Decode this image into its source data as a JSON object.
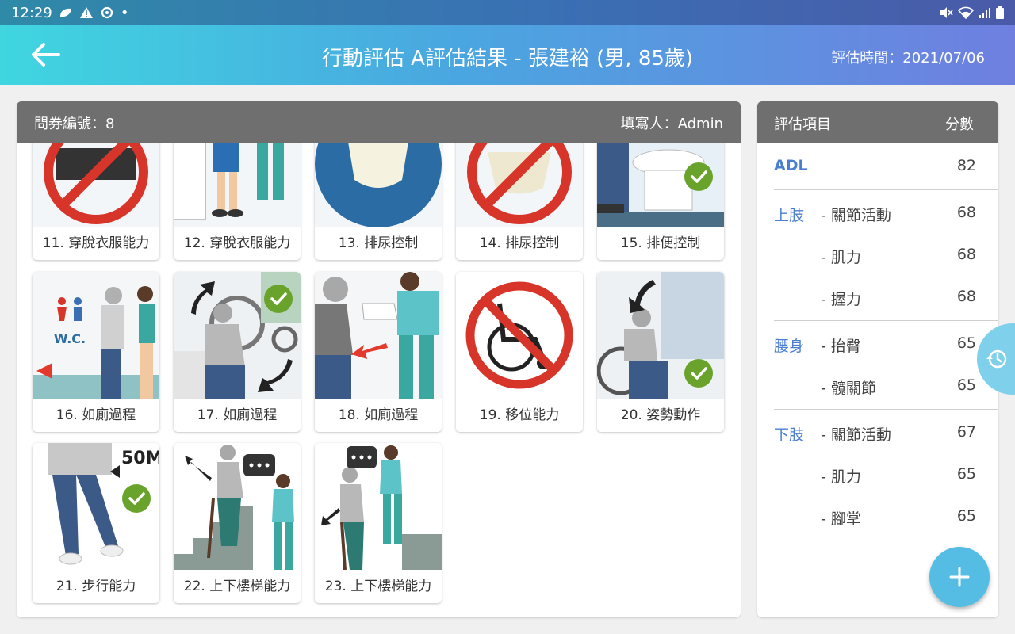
{
  "status_bar": {
    "time": "12:29",
    "dot": "•"
  },
  "app_bar": {
    "title": "行動評估 A評估結果 - 張建裕 (男, 85歲)",
    "assess_time": "評估時間：2021/07/06"
  },
  "panel": {
    "questionnaire_no": "問券編號：8",
    "filled_by": "填寫人：Admin"
  },
  "cards": [
    {
      "label": "11. 穿脫衣服能力",
      "checked": false,
      "icon": "no-symbol"
    },
    {
      "label": "12. 穿脫衣服能力",
      "checked": false,
      "icon": "people-standing"
    },
    {
      "label": "13. 排尿控制",
      "checked": false,
      "icon": "diaper-blue"
    },
    {
      "label": "14. 排尿控制",
      "checked": false,
      "icon": "no-symbol"
    },
    {
      "label": "15. 排便控制",
      "checked": true,
      "icon": "toilet"
    },
    {
      "label": "16. 如廁過程",
      "checked": false,
      "icon": "wc-assist"
    },
    {
      "label": "17. 如廁過程",
      "checked": true,
      "icon": "wheelchair-transfer"
    },
    {
      "label": "18. 如廁過程",
      "checked": false,
      "icon": "caregiver-assist"
    },
    {
      "label": "19. 移位能力",
      "checked": false,
      "icon": "no-wheelchair"
    },
    {
      "label": "20. 姿勢動作",
      "checked": true,
      "icon": "wheelchair-posture"
    },
    {
      "label": "21. 步行能力",
      "checked": true,
      "icon": "walking-50m",
      "badge": "50M"
    },
    {
      "label": "22. 上下樓梯能力",
      "checked": false,
      "icon": "stairs-up"
    },
    {
      "label": "23. 上下樓梯能力",
      "checked": false,
      "icon": "stairs-down"
    }
  ],
  "side": {
    "header_item": "評估項目",
    "header_score": "分數",
    "rows": [
      {
        "cat": "ADL",
        "sub": "",
        "score": "82"
      },
      {
        "cat": "上肢",
        "sub": "- 關節活動",
        "score": "68"
      },
      {
        "cat": "",
        "sub": "- 肌力",
        "score": "68"
      },
      {
        "cat": "",
        "sub": "- 握力",
        "score": "68"
      },
      {
        "cat": "腰身",
        "sub": "- 抬臀",
        "score": "65"
      },
      {
        "cat": "",
        "sub": "- 髖關節",
        "score": "65"
      },
      {
        "cat": "下肢",
        "sub": "- 關節活動",
        "score": "67"
      },
      {
        "cat": "",
        "sub": "- 肌力",
        "score": "65"
      },
      {
        "cat": "",
        "sub": "- 腳掌",
        "score": "65"
      }
    ]
  },
  "colors": {
    "accent": "#4a7fd0",
    "check": "#6aa32c",
    "header_gray": "#6f6f6f",
    "fab": "#55bde3"
  }
}
